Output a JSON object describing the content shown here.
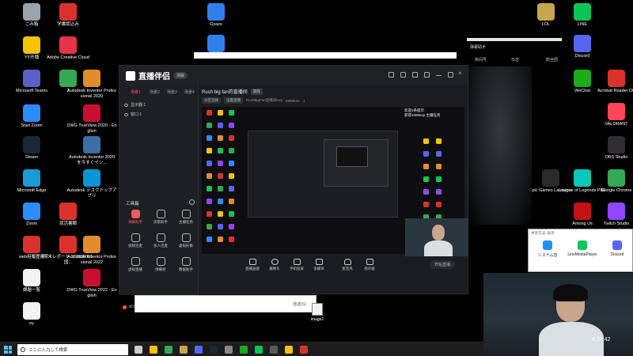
{
  "desktop_left": [
    {
      "label": "ごみ箱",
      "icon": "recycle-bin-icon",
      "color": "#9aa3ad"
    },
    {
      "label": "学書認込み",
      "icon": "pdf-icon",
      "color": "#d9322b"
    },
    {
      "label": "YY开播",
      "icon": "yy-icon",
      "color": "#f5c400"
    },
    {
      "label": "Adobe Creative Cloud",
      "icon": "creative-cloud-icon",
      "color": "#e3344a"
    },
    {
      "label": "Microsoft Teams",
      "icon": "teams-icon",
      "color": "#5b5fc7"
    },
    {
      "label": "2",
      "icon": "chrome-icon",
      "color": "#34a853"
    },
    {
      "label": "Autodesk Inventor Professional 2020",
      "icon": "inventor-icon",
      "color": "#e38c2b"
    },
    {
      "label": "Start Zoom",
      "icon": "zoom-icon",
      "color": "#2d8cff"
    },
    {
      "label": "DWG TrueView 2020 - English",
      "icon": "dwg-icon",
      "color": "#c8102e"
    },
    {
      "label": "Steam",
      "icon": "steam-icon",
      "color": "#1b2838"
    },
    {
      "label": "Autodesk Inventor 2020 を今すぐイン...",
      "icon": "inventor-install-icon",
      "color": "#3a6ea5"
    },
    {
      "label": "Microsoft Edge",
      "icon": "edge-icon",
      "color": "#1a9ad7"
    },
    {
      "label": "Autodesk デスクトップアプリ",
      "icon": "autodesk-icon",
      "color": "#0696d7"
    },
    {
      "label": "Zoom",
      "icon": "zoom-icon",
      "color": "#2d8cff"
    },
    {
      "label": "就活書類",
      "icon": "pdf-icon",
      "color": "#d9322b"
    },
    {
      "label": "web用履歴書",
      "icon": "pdf-icon",
      "color": "#d9322b"
    },
    {
      "label": "期末レポート 171030001国...",
      "icon": "pdf-icon",
      "color": "#d9322b"
    },
    {
      "label": "Autodesk Inventor Professional 2022",
      "icon": "inventor-icon",
      "color": "#e38c2b"
    },
    {
      "label": "課題一覧",
      "icon": "document-icon",
      "color": "#f2f2f2"
    },
    {
      "label": "DWG TrueView 2022 - English",
      "icon": "dwg-icon",
      "color": "#c8102e"
    },
    {
      "label": "ey",
      "icon": "document-icon",
      "color": "#f2f2f2"
    }
  ],
  "desktop_top": [
    {
      "label": "Gyazo",
      "icon": "gyazo-icon",
      "color": "#2f80ed"
    },
    {
      "label": "",
      "icon": "gyazo-icon",
      "color": "#2f80ed"
    }
  ],
  "desktop_right": [
    {
      "label": "LOL",
      "icon": "lol-icon",
      "color": "#c8a44d"
    },
    {
      "label": "LINE",
      "icon": "line-icon",
      "color": "#06c755"
    },
    {
      "label": "Discord",
      "icon": "discord-icon",
      "color": "#5865f2"
    },
    {
      "label": "WeChat",
      "icon": "wechat-icon",
      "color": "#1aad19"
    },
    {
      "label": "Acrobat Reader DC",
      "icon": "acrobat-icon",
      "color": "#d9322b"
    },
    {
      "label": "VALORANT",
      "icon": "valorant-icon",
      "color": "#ff4655"
    },
    {
      "label": "OBS Studio",
      "icon": "obs-icon",
      "color": "#302e31"
    },
    {
      "label": "Epic Games Launcher",
      "icon": "epic-icon",
      "color": "#2a2a2a"
    },
    {
      "label": "League of Legends PBE",
      "icon": "lol-pbe-icon",
      "color": "#0ac8b9"
    },
    {
      "label": "Google Chrome",
      "icon": "chrome-icon",
      "color": "#34a853"
    },
    {
      "label": "Among Us",
      "icon": "among-us-icon",
      "color": "#c51111"
    },
    {
      "label": "Twitch Studio",
      "icon": "twitch-icon",
      "color": "#9146ff"
    }
  ],
  "app": {
    "logo_text": "直播伴侣",
    "version_badge": "测版",
    "scene_tabs": [
      "场景1",
      "场景2",
      "场景3",
      "场景4"
    ],
    "scene_rows": [
      "显示器 1",
      "窗口 1"
    ],
    "tools_label": "工具箱",
    "tools": [
      {
        "label": "弹幕助手",
        "active": true
      },
      {
        "label": "房管助手",
        "active": false
      },
      {
        "label": "主播任务",
        "active": false
      },
      {
        "label": "视频连麦",
        "active": false
      },
      {
        "label": "多人连麦",
        "active": false
      },
      {
        "label": "虚拟形象",
        "active": false
      },
      {
        "label": "虚拟直播",
        "active": false
      },
      {
        "label": "弹幕姬",
        "active": false
      },
      {
        "label": "数据助手",
        "active": false
      }
    ],
    "left_bottom": "如何把手机游戏投屏直播中?",
    "stream_title": "Rush big fan的直播间",
    "stream_title_tag": "游戏",
    "stream_sub_tags": [
      "分区选择",
      "设置直播"
    ],
    "stream_meta": "RushBigFan直播间Key",
    "viewer_count": "4",
    "room_id": "6885642",
    "overlay_chat": [
      "欢迎1条提示",
      "获得1000exp 主播任务"
    ],
    "bottom_bar": [
      "直播画面",
      "摄像头",
      "手机投屏",
      "多媒体",
      "麦克风",
      "扬声器"
    ],
    "start_button": "开始直播"
  },
  "stream_helper": {
    "title": "弹幕助手",
    "buttons": [
      "房间号",
      "日志",
      "粉丝团"
    ]
  },
  "share_popup": {
    "header": "共享方法: 表示",
    "options": [
      {
        "label": "システム音",
        "icon": "speaker-icon",
        "color": "#1e90ff"
      },
      {
        "label": "LineMediaPlayer",
        "icon": "line-media-icon",
        "color": "#06c755"
      },
      {
        "label": "Discord",
        "icon": "discord-icon",
        "color": "#5865f2"
      }
    ]
  },
  "blank_dialog": {
    "text": "放送(S)"
  },
  "image2": {
    "label": "image2"
  },
  "camera": {
    "time": "4:37:42"
  },
  "taskbar": {
    "search_placeholder": "ここに入力して検索",
    "apps": [
      {
        "icon": "task-view-icon",
        "color": "#cccccc"
      },
      {
        "icon": "explorer-icon",
        "color": "#f5c400"
      },
      {
        "icon": "chrome-icon",
        "color": "#34a853"
      },
      {
        "icon": "lol-icon",
        "color": "#c8a44d"
      },
      {
        "icon": "discord-icon",
        "color": "#5865f2"
      },
      {
        "icon": "steam-icon",
        "color": "#1b2838"
      },
      {
        "icon": "shield-icon",
        "color": "#888888"
      },
      {
        "icon": "wechat-icon",
        "color": "#1aad19"
      },
      {
        "icon": "line-icon",
        "color": "#06c755"
      },
      {
        "icon": "obs-icon",
        "color": "#5a5a5a"
      },
      {
        "icon": "yy-icon",
        "color": "#f5c400"
      },
      {
        "icon": "livehelper-icon",
        "color": "#d9322b"
      }
    ]
  }
}
